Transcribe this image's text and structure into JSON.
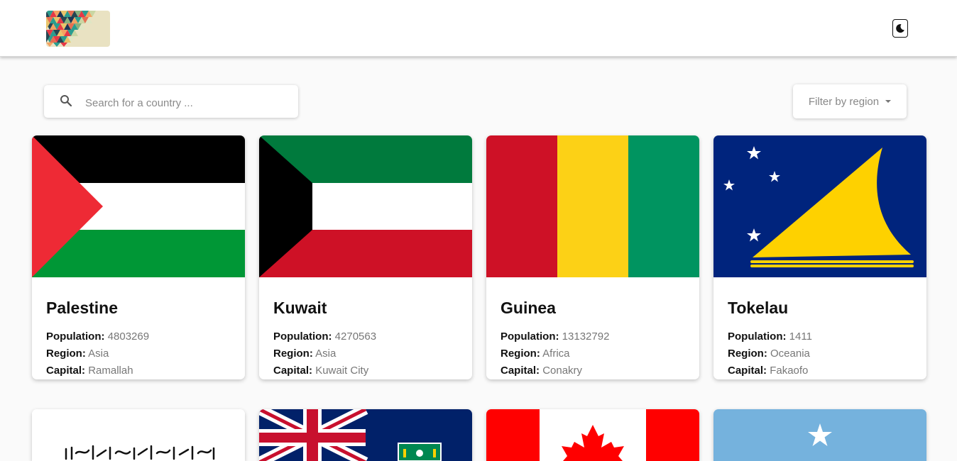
{
  "header": {
    "logo_alt": "logo",
    "theme_icon": "moon-icon"
  },
  "search": {
    "placeholder": "Search for a country ...",
    "value": "",
    "icon": "search-icon"
  },
  "filter": {
    "label": "Filter by region",
    "icon": "caret-down-icon"
  },
  "labels": {
    "population": "Population:",
    "region": "Region:",
    "capital": "Capital:"
  },
  "countries": [
    {
      "name": "Palestine",
      "population": "4803269",
      "region": "Asia",
      "capital": "Ramallah"
    },
    {
      "name": "Kuwait",
      "population": "4270563",
      "region": "Asia",
      "capital": "Kuwait City"
    },
    {
      "name": "Guinea",
      "population": "13132792",
      "region": "Africa",
      "capital": "Conakry"
    },
    {
      "name": "Tokelau",
      "population": "1411",
      "region": "Oceania",
      "capital": "Fakaofo"
    }
  ],
  "colors": {
    "background": "#fafafa",
    "card": "#ffffff",
    "muted_text": "#777777",
    "palestine_red": "#EE2A35",
    "palestine_green": "#009736",
    "kuwait_green": "#007A3D",
    "kuwait_red": "#CE1126",
    "guinea_red": "#CE1126",
    "guinea_yellow": "#FCD116",
    "guinea_green": "#009460",
    "tokelau_blue": "#00247D",
    "tokelau_yellow": "#FED100",
    "canada_red": "#FF0000",
    "somalia_blue": "#4189DD"
  }
}
